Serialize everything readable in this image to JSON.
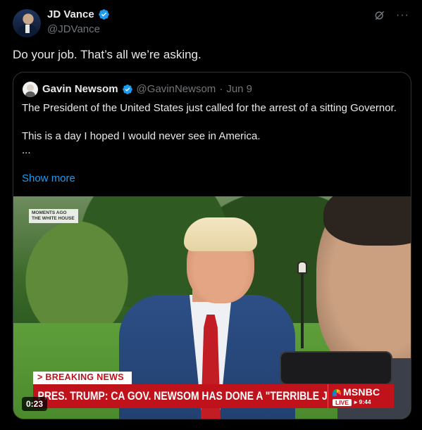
{
  "author": {
    "name": "JD Vance",
    "handle": "@JDVance"
  },
  "tweet_text": "Do your job. That’s all we’re asking.",
  "top_icons": [
    "grok-icon",
    "more-icon"
  ],
  "more_label": "···",
  "quote": {
    "name": "Gavin Newsom",
    "handle": "@GavinNewsom",
    "separator": "·",
    "date": "Jun 9",
    "text": "The President of the United States just called for the arrest of a sitting Governor.\n\nThis is a day I hoped I would never see in America.\n...",
    "show_more": "Show more"
  },
  "video": {
    "overlay_label": "MOMENTS AGO\nTHE WHITE HOUSE",
    "breaking_label": "> BREAKING NEWS",
    "ticker_text": "PRES. TRUMP: CA GOV. NEWSOM HAS DONE A \"TERRIBLE JOB\"",
    "network": "MSNBC",
    "live_label": "LIVE",
    "live_time": "▸ 9:44",
    "duration": "0:23"
  },
  "colors": {
    "background": "#000000",
    "text": "#e7e9ea",
    "muted": "#71767b",
    "link": "#1d9bf0",
    "verified": "#1d9bf0",
    "border": "#2f3336",
    "ticker_red": "#c0121b"
  }
}
